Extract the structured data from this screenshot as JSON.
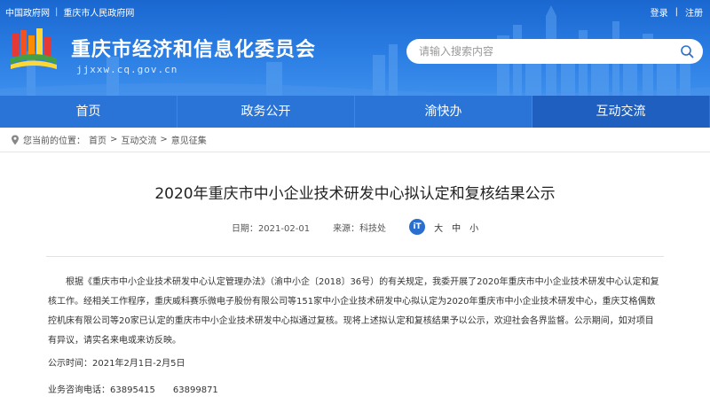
{
  "header": {
    "top_left_links": [
      "中国政府网",
      "重庆市人民政府网"
    ],
    "login": "登录",
    "register": "注册",
    "site_title": "重庆市经济和信息化委员会",
    "site_domain": "jjxxw.cq.gov.cn",
    "search_placeholder": "请输入搜索内容",
    "colors": {
      "header_blue": "#2a7de3",
      "nav_blue": "#2a74d8"
    }
  },
  "nav": {
    "items": [
      "首页",
      "政务公开",
      "渝快办",
      "互动交流"
    ],
    "active": "互动交流"
  },
  "breadcrumb": {
    "prefix": "您当前的位置：",
    "items": [
      "首页",
      "互动交流",
      "意见征集"
    ]
  },
  "article": {
    "title": "2020年重庆市中小企业技术研发中心拟认定和复核结果公示",
    "date_label": "日期：",
    "date": "2021-02-01",
    "source_label": "来源：",
    "source": "科技处",
    "font_sizes": [
      "大",
      "中",
      "小"
    ],
    "paragraph1": "根据《重庆市中小企业技术研发中心认定管理办法》（渝中小企〔2018〕36号）的有关规定，我委开展了2020年重庆市中小企业技术研发中心认定和复核工作。经相关工作程序，重庆威科赛乐微电子股份有限公司等151家中小企业技术研发中心拟认定为2020年重庆市中小企业技术研发中心，重庆艾格偶数控机床有限公司等20家已认定的重庆市中小企业技术研发中心拟通过复核。现将上述拟认定和复核结果予以公示，欢迎社会各界监督。公示期间，如对项目有异议，请实名来电或来访反映。",
    "period_label": "公示时间：",
    "period": "2021年2月1日-2月5日",
    "phone_label": "业务咨询电话：",
    "phones": "63895415　　63899871"
  }
}
